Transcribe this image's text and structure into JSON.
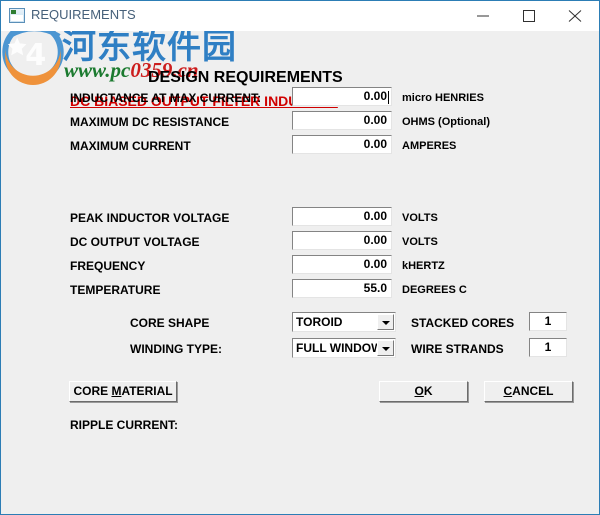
{
  "window": {
    "title": "REQUIREMENTS",
    "icon": "application-icon",
    "controls": {
      "minimize": "minimize-icon",
      "maximize": "maximize-icon",
      "close": "close-icon"
    }
  },
  "watermark": {
    "site_cn": "河东软件园",
    "url_prefix": "www.pc",
    "url_suffix": "0359.cn",
    "logo": "watermark-logo"
  },
  "headings": {
    "main": "DESIGN REQUIREMENTS",
    "sub": "DC BIASED OUTPUT FILTER INDUCTOR"
  },
  "fields": [
    {
      "label": "INDUCTANCE AT MAX CURRENT:",
      "value": "0.00",
      "unit": "micro HENRIES",
      "focused": true
    },
    {
      "label": "MAXIMUM DC RESISTANCE",
      "value": "0.00",
      "unit": "OHMS (Optional)",
      "focused": false
    },
    {
      "label": "MAXIMUM CURRENT",
      "value": "0.00",
      "unit": "AMPERES",
      "focused": false
    },
    {
      "label": "PEAK INDUCTOR VOLTAGE",
      "value": "0.00",
      "unit": "VOLTS",
      "focused": false
    },
    {
      "label": "DC OUTPUT VOLTAGE",
      "value": "0.00",
      "unit": "VOLTS",
      "focused": false
    },
    {
      "label": "FREQUENCY",
      "value": "0.00",
      "unit": "kHERTZ",
      "focused": false
    },
    {
      "label": "TEMPERATURE",
      "value": "55.0",
      "unit": "DEGREES C",
      "focused": false
    }
  ],
  "selects": [
    {
      "label": "CORE SHAPE",
      "value": "TOROID"
    },
    {
      "label": "WINDING TYPE:",
      "value": "FULL WINDOW"
    }
  ],
  "counters": [
    {
      "label": "STACKED CORES",
      "value": "1"
    },
    {
      "label": "WIRE STRANDS",
      "value": "1"
    }
  ],
  "buttons": {
    "core_material": {
      "pre": "CORE ",
      "accel": "M",
      "post": "ATERIAL"
    },
    "ok": {
      "pre": "",
      "accel": "O",
      "post": "K"
    },
    "cancel": {
      "pre": "",
      "accel": "C",
      "post": "ANCEL"
    }
  },
  "status": {
    "ripple_current": "RIPPLE CURRENT:"
  },
  "colors": {
    "window_border": "#2c7db5",
    "client_bg": "#efefef",
    "heading_sub": "#d00000",
    "watermark_blue": "#2f7fc4",
    "watermark_green": "#1b7a2f",
    "watermark_red": "#cc1d1d"
  }
}
